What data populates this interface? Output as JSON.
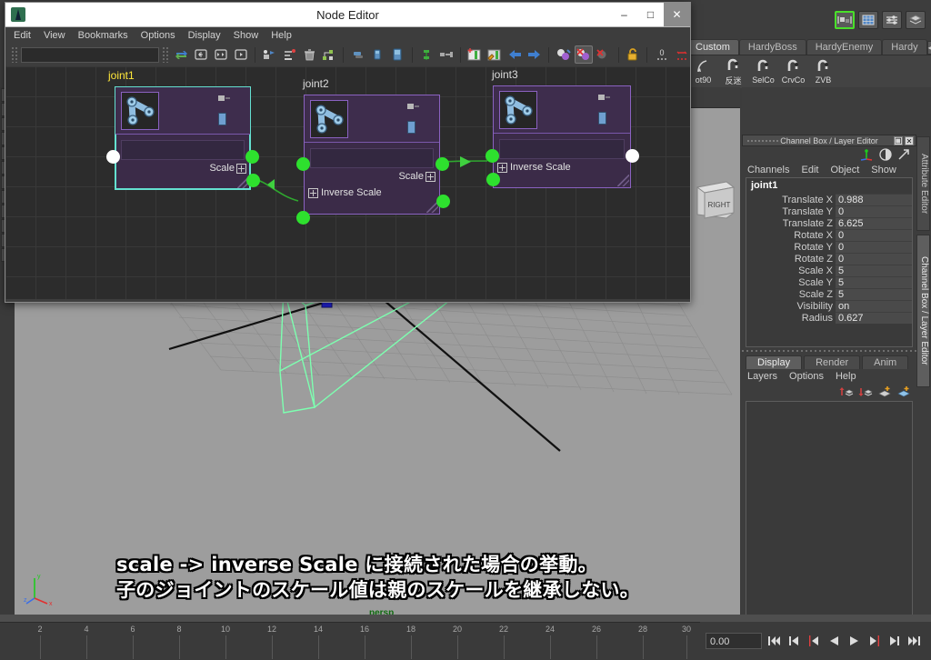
{
  "shelf": {
    "tabs": [
      {
        "label": "Custom",
        "active": true
      },
      {
        "label": "HardyBoss",
        "active": false
      },
      {
        "label": "HardyEnemy",
        "active": false
      },
      {
        "label": "Hardy",
        "active": false
      }
    ],
    "items": [
      {
        "label": "ot90"
      },
      {
        "label": "反迷"
      },
      {
        "label": "SelCo"
      },
      {
        "label": "CrvCo"
      },
      {
        "label": "ZVB"
      }
    ]
  },
  "node_editor": {
    "title": "Node Editor",
    "window_buttons": {
      "minimize": "–",
      "maximize": "□",
      "close": "✕"
    },
    "menus": [
      "Edit",
      "View",
      "Bookmarks",
      "Options",
      "Display",
      "Show",
      "Help"
    ],
    "search_value": "",
    "nodes": [
      {
        "name": "joint1",
        "selected": true,
        "left_port": "white",
        "right_port": "green",
        "attrs": [
          {
            "label": "Scale",
            "side": "right",
            "port": "green"
          }
        ]
      },
      {
        "name": "joint2",
        "selected": false,
        "left_port": "green",
        "right_port": "green",
        "attrs": [
          {
            "label": "Scale",
            "side": "right",
            "port": "green"
          },
          {
            "label": "Inverse Scale",
            "side": "left",
            "port": "green"
          }
        ]
      },
      {
        "name": "joint3",
        "selected": false,
        "left_port": "green",
        "right_port": "white",
        "attrs": [
          {
            "label": "Inverse Scale",
            "side": "left",
            "port": "green"
          }
        ]
      }
    ],
    "connections": [
      {
        "from": "joint1.Scale",
        "to": "joint2.Inverse Scale"
      },
      {
        "from": "joint2.Scale",
        "to": "joint3.Inverse Scale"
      }
    ]
  },
  "viewport": {
    "camera_label": "persp",
    "viewcube_label": "RIGHT",
    "axis_labels": {
      "x": "x",
      "y": "y",
      "z": "z"
    },
    "subtitle_line1": "scale -> inverse Scale に接続された場合の挙動。",
    "subtitle_line2": "子のジョイントのスケール値は親のスケールを継承しない。"
  },
  "channel_box": {
    "panel_title": "Channel Box / Layer Editor",
    "menus": [
      "Channels",
      "Edit",
      "Object",
      "Show"
    ],
    "object_name": "joint1",
    "rows": [
      {
        "name": "Translate X",
        "value": "0.988"
      },
      {
        "name": "Translate Y",
        "value": "0"
      },
      {
        "name": "Translate Z",
        "value": "6.625"
      },
      {
        "name": "Rotate X",
        "value": "0"
      },
      {
        "name": "Rotate Y",
        "value": "0"
      },
      {
        "name": "Rotate Z",
        "value": "0"
      },
      {
        "name": "Scale X",
        "value": "5"
      },
      {
        "name": "Scale Y",
        "value": "5"
      },
      {
        "name": "Scale Z",
        "value": "5"
      },
      {
        "name": "Visibility",
        "value": "on"
      },
      {
        "name": "Radius",
        "value": "0.627"
      }
    ]
  },
  "layer_editor": {
    "tabs": [
      {
        "label": "Display",
        "active": true
      },
      {
        "label": "Render",
        "active": false
      },
      {
        "label": "Anim",
        "active": false
      }
    ],
    "menus": [
      "Layers",
      "Options",
      "Help"
    ]
  },
  "side_tabs": [
    {
      "label": "Attribute Editor",
      "active": false
    },
    {
      "label": "Channel Box / Layer Editor",
      "active": true
    }
  ],
  "timeline": {
    "ticks": [
      2,
      4,
      6,
      8,
      10,
      12,
      14,
      16,
      18,
      20,
      22,
      24,
      26,
      28,
      30
    ],
    "current_time": "0.00"
  },
  "colors": {
    "node_purple": "#3b2b48",
    "node_border": "#8a62c0",
    "selected_border": "#64e0d0",
    "port_green": "#2ee02e",
    "label_yellow": "#ffe83a",
    "viewport_bg": "#9d9d9d",
    "joint_green": "#7dffb0"
  }
}
